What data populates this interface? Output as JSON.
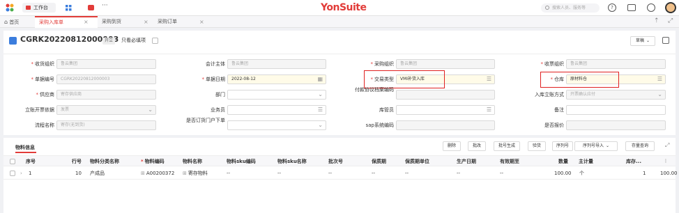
{
  "topbar": {
    "workbench_label": "工作台",
    "more_label": "···",
    "brand": "YonSuite",
    "search_placeholder": "搜索人员、服务等"
  },
  "tabs": [
    {
      "label": "首页"
    },
    {
      "label": "采购入库单"
    },
    {
      "label": "采购到货"
    },
    {
      "label": "采购订单"
    }
  ],
  "header": {
    "doc_no": "CGRK20220812000003",
    "status": "开立",
    "only_required": "只看必填项",
    "draft_btn": "草稿"
  },
  "form": {
    "receive_org_label": "收货组织",
    "receive_org_value": "鲁云集团",
    "account_entity_label": "会计主体",
    "account_entity_value": "鲁云集团",
    "purchase_org_label": "采购组织",
    "purchase_org_value": "鲁云集团",
    "invoice_org_label": "收票组织",
    "invoice_org_value": "鲁云集团",
    "doc_no_label": "单据编号",
    "doc_no_value": "CGRK20220812000003",
    "doc_date_label": "单据日期",
    "doc_date_value": "2022-08-12",
    "trade_type_label": "交易类型",
    "trade_type_value": "VMI补货入库",
    "warehouse_label": "仓库",
    "warehouse_value": "原材料仓",
    "supplier_label": "供应商",
    "supplier_value": "寄存供应商",
    "dept_label": "部门",
    "dept_value": "",
    "payment_agreement_label": "付款协议档案编码",
    "payment_agreement_value": "",
    "inbound_method_label": "入库立账方式",
    "inbound_method_value": "开票确认应付",
    "invoice_basis_label": "立账开票依据",
    "invoice_basis_value": "发票",
    "salesman_label": "业务员",
    "salesman_value": "",
    "keeper_label": "库管员",
    "keeper_value": "",
    "remark_label": "备注",
    "remark_value": "",
    "flow_label": "流程名称",
    "flow_value": "寄存(无到货)",
    "order_inbound_label": "是否订货门户下单",
    "order_inbound_value": "",
    "sap_label": "sap系统编码",
    "sap_value": "",
    "quote_label": "是否报价",
    "quote_value": ""
  },
  "section": {
    "material_tab": "物料信息",
    "buttons": [
      "删除",
      "批改",
      "批号生成",
      "验货",
      "序列号",
      "序列号导入",
      "存量查询"
    ]
  },
  "table": {
    "headers": [
      "序号",
      "行号",
      "物料分类名称",
      "物料编码",
      "物料名称",
      "物料sku编码",
      "物料sku名称",
      "批次号",
      "保质期",
      "保质期单位",
      "生产日期",
      "有效期至",
      "数量",
      "主计量",
      "库存..."
    ],
    "rows": [
      [
        "1",
        "10",
        "产成品",
        "A00200372",
        "寄存物料",
        "--",
        "--",
        "--",
        "--",
        "--",
        "--",
        "--",
        "100.00",
        "个",
        "1",
        "100.00"
      ]
    ]
  },
  "colors": {
    "accent": "#e23c39",
    "highlight_box": "#e02020",
    "edit_field_bg": "#fffbe8"
  }
}
